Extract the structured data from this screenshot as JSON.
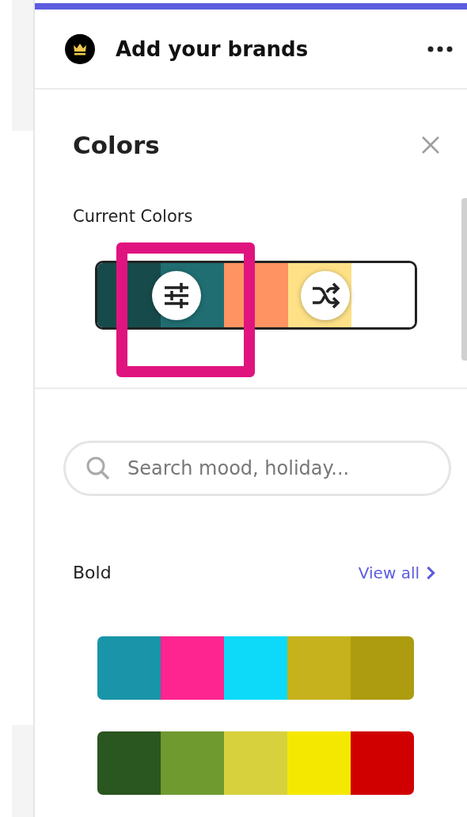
{
  "header": {
    "title": "Add your brands"
  },
  "panel": {
    "title": "Colors",
    "current_label": "Current Colors",
    "current_colors": [
      {
        "color": "#174b4b"
      },
      {
        "color": "#206e72"
      },
      {
        "color": "#ff9462"
      },
      {
        "color": "#fee187"
      },
      {
        "color": "#ffffff"
      }
    ],
    "annotation": {
      "kind": "highlight-box",
      "color": "#e0147f"
    },
    "search": {
      "placeholder": "Search mood, holiday..."
    },
    "section": {
      "title": "Bold",
      "link": "View all"
    },
    "palettes": [
      [
        {
          "color": "#1a94a9"
        },
        {
          "color": "#fe2590"
        },
        {
          "color": "#0cdaf8"
        },
        {
          "color": "#c5b21c"
        },
        {
          "color": "#ad9b10"
        }
      ],
      [
        {
          "color": "#2a5620"
        },
        {
          "color": "#6f9a2f"
        },
        {
          "color": "#d7d13e"
        },
        {
          "color": "#f5e800"
        },
        {
          "color": "#d00000"
        }
      ]
    ]
  }
}
